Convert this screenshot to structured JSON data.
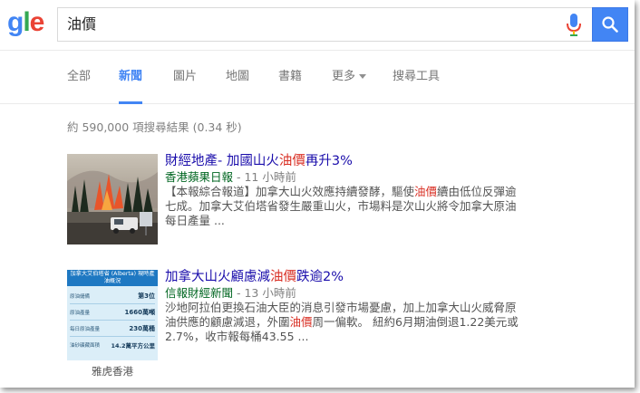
{
  "logo": {
    "part1": "g",
    "part2": "l",
    "part3": "e"
  },
  "search": {
    "query": "油價",
    "mic_icon": "mic-icon",
    "button_icon": "magnifier-icon"
  },
  "tabs": [
    {
      "label": "全部"
    },
    {
      "label": "新聞",
      "active": true
    },
    {
      "label": "圖片"
    },
    {
      "label": "地圖"
    },
    {
      "label": "書籍"
    },
    {
      "label": "更多"
    },
    {
      "label": "搜尋工具"
    }
  ],
  "stats": "約 590,000 項搜尋結果 (0.34 秒)",
  "results": [
    {
      "title_pre": "財經地產- 加國山火",
      "title_hl": "油價",
      "title_post": "再升3%",
      "source": "香港蘋果日報",
      "time": " - 11 小時前",
      "snippet_line1_pre": "【本報綜合報道】加拿大山火效應持續發酵，驅使",
      "snippet_line1_hl": "油價",
      "snippet_line1_post": "續由低位反彈逾",
      "snippet_line2": "七成。加拿大艾伯塔省發生嚴重山火，市場料是次山火將令加拿大原油",
      "snippet_line3": "每日產量 ..."
    },
    {
      "title_pre": "加拿大山火顧慮減",
      "title_hl": "油價",
      "title_post": "跌逾2%",
      "source": "信報財經新聞",
      "time": " - 13 小時前",
      "snippet_line1": "沙地阿拉伯更換石油大臣的消息引發市場憂慮，加上加拿大山火威脅原",
      "snippet_line2_pre": "油供應的顧慮減退，外圍",
      "snippet_line2_hl": "油價",
      "snippet_line2_post": "周一偏軟。 紐約6月期油倒退1.22美元或",
      "snippet_line3": "2.7%，收市報每桶43.55 ...",
      "thumb_caption": "雅虎香港"
    }
  ],
  "thumb2": {
    "header": "加拿大艾伯塔省 (Alberta) 現時產油概況",
    "rows": [
      {
        "label": "原油儲備",
        "value": "第3位"
      },
      {
        "label": "原油產量",
        "value": "1660萬噸"
      },
      {
        "label": "每日原油產量",
        "value": "230萬桶"
      },
      {
        "label": "油砂礦藏面積",
        "value": "14.2萬平方公里"
      }
    ]
  },
  "colors": {
    "accent": "#4285f4",
    "link": "#1a0dab",
    "highlight": "#d93025",
    "source": "#006621"
  }
}
